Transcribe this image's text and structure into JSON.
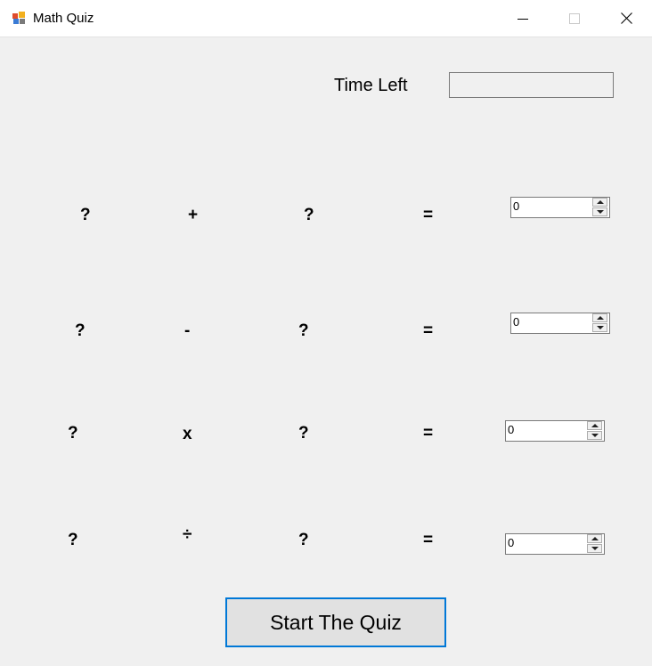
{
  "window": {
    "title": "Math Quiz",
    "icon": "form-app-icon",
    "controls": [
      "minimize-icon",
      "maximize-icon",
      "close-icon"
    ]
  },
  "timer": {
    "label": "Time Left",
    "value": ""
  },
  "problems": [
    {
      "left": "?",
      "operator": "+",
      "right": "?",
      "equals": "=",
      "answer": "0"
    },
    {
      "left": "?",
      "operator": "-",
      "right": "?",
      "equals": "=",
      "answer": "0"
    },
    {
      "left": "?",
      "operator": "x",
      "right": "?",
      "equals": "=",
      "answer": "0"
    },
    {
      "left": "?",
      "operator": "÷",
      "right": "?",
      "equals": "=",
      "answer": "0"
    }
  ],
  "start_button": {
    "label": "Start The Quiz",
    "focus_color": "#0078d7"
  }
}
